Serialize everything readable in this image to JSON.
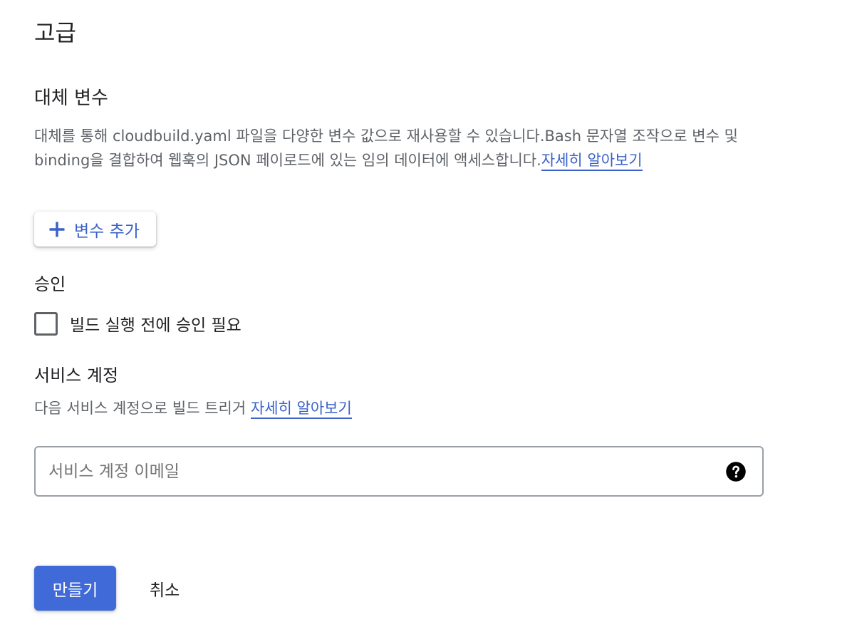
{
  "advanced": {
    "title": "고급"
  },
  "substitutions": {
    "title": "대체 변수",
    "description": "대체를 통해 cloudbuild.yaml 파일을 다양한 변수 값으로 재사용할 수 있습니다.Bash 문자열 조작으로 변수 및 binding을 결합하여 웹훅의 JSON 페이로드에 있는 임의 데이터에 액세스합니다.",
    "learn_more": "자세히 알아보기",
    "add_button_label": "변수 추가",
    "add_icon": "plus-icon"
  },
  "approval": {
    "title": "승인",
    "checkbox_label": "빌드 실행 전에 승인 필요",
    "checked": false
  },
  "service_account": {
    "title": "서비스 계정",
    "description": "다음 서비스 계정으로 빌드 트리거",
    "learn_more": "자세히 알아보기",
    "input_placeholder": "서비스 계정 이메일",
    "input_value": "",
    "help_icon": "help-icon"
  },
  "actions": {
    "create_label": "만들기",
    "cancel_label": "취소"
  },
  "colors": {
    "accent": "#3f6ad8",
    "link": "#3b62c9",
    "text_primary": "#202124",
    "text_secondary": "#5f6368"
  }
}
